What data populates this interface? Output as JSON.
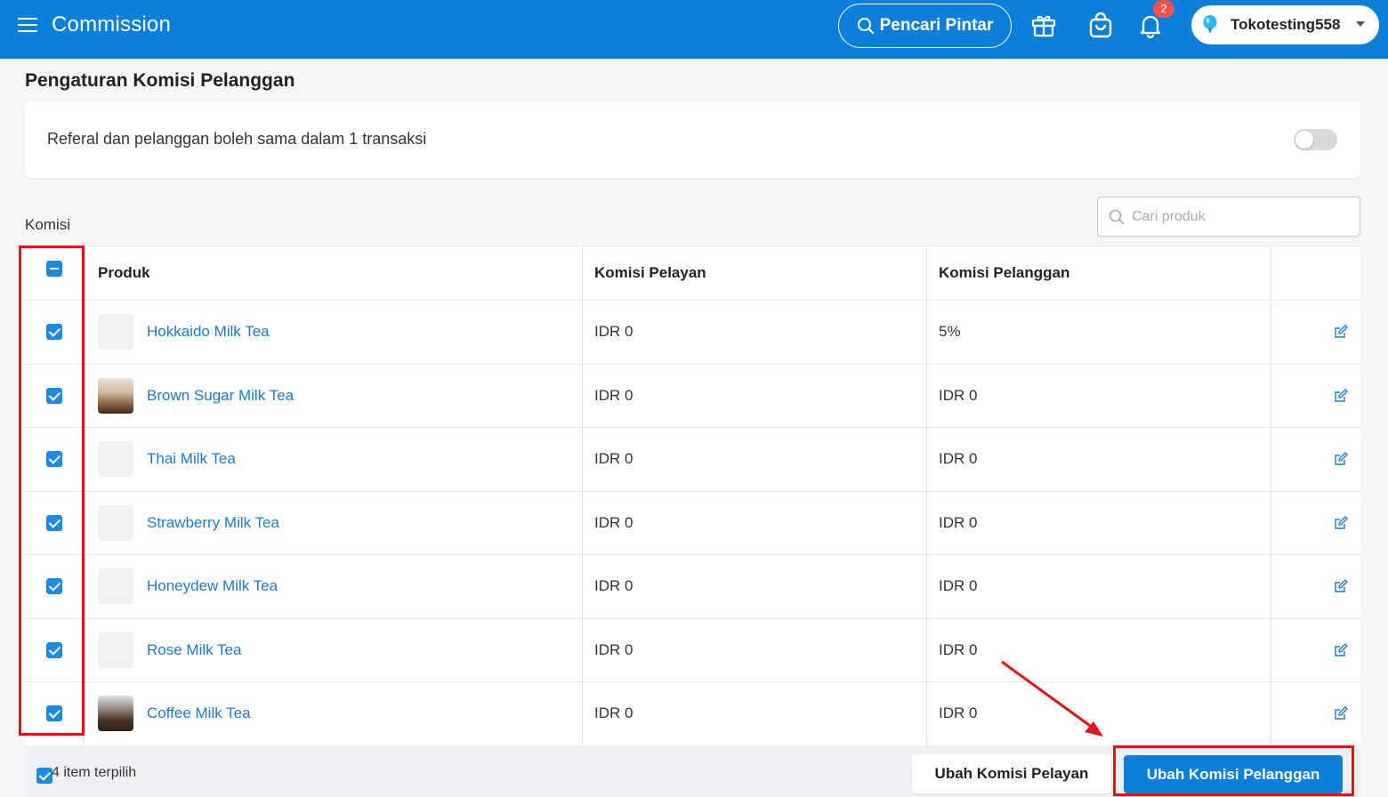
{
  "header": {
    "title": "Commission",
    "smart_search_label": "Pencari Pintar",
    "notification_count": "2",
    "store_name": "Tokotesting558"
  },
  "page": {
    "title": "Pengaturan Komisi Pelanggan",
    "setting_label": "Referal dan pelanggan boleh sama dalam 1 transaksi",
    "setting_enabled": false,
    "section_label": "Komisi",
    "search_placeholder": "Cari produk"
  },
  "table": {
    "headers": {
      "produk": "Produk",
      "komisi_pelayan": "Komisi Pelayan",
      "komisi_pelanggan": "Komisi Pelanggan"
    },
    "rows": [
      {
        "name": "Hokkaido Milk Tea",
        "komisi_pelayan": "IDR 0",
        "komisi_pelanggan": "5%",
        "checked": true
      },
      {
        "name": "Brown Sugar Milk Tea",
        "komisi_pelayan": "IDR 0",
        "komisi_pelanggan": "IDR 0",
        "checked": true
      },
      {
        "name": "Thai Milk Tea",
        "komisi_pelayan": "IDR 0",
        "komisi_pelanggan": "IDR 0",
        "checked": true
      },
      {
        "name": "Strawberry Milk Tea",
        "komisi_pelayan": "IDR 0",
        "komisi_pelanggan": "IDR 0",
        "checked": true
      },
      {
        "name": "Honeydew Milk Tea",
        "komisi_pelayan": "IDR 0",
        "komisi_pelanggan": "IDR 0",
        "checked": true
      },
      {
        "name": "Rose Milk Tea",
        "komisi_pelayan": "IDR 0",
        "komisi_pelanggan": "IDR 0",
        "checked": true
      },
      {
        "name": "Coffee Milk Tea",
        "komisi_pelayan": "IDR 0",
        "komisi_pelanggan": "IDR 0",
        "checked": true
      }
    ]
  },
  "footer": {
    "selected_text": "4 item terpilih",
    "btn_pelayan": "Ubah Komisi Pelayan",
    "btn_pelanggan": "Ubah Komisi Pelanggan"
  },
  "colors": {
    "primary": "#0e7fd9",
    "link": "#1a7bc4",
    "annotation": "#e01616"
  }
}
